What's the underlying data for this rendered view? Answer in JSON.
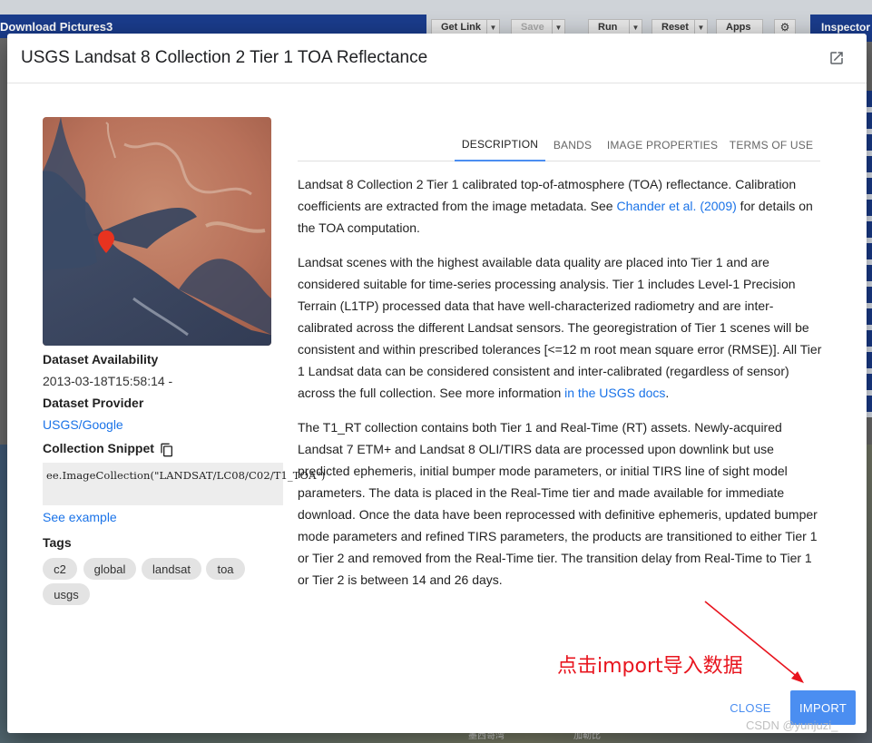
{
  "background": {
    "title": "Download Pictures3",
    "buttons": [
      "Get Link",
      "Save",
      "Run",
      "Reset",
      "Apps"
    ],
    "inspector": "Inspector",
    "map_labels": [
      "墨西哥湾",
      "加勒比"
    ]
  },
  "dialog": {
    "title": "USGS Landsat 8 Collection 2 Tier 1 TOA Reflectance",
    "sidebar": {
      "availability_label": "Dataset Availability",
      "availability_value": "2013-03-18T15:58:14 -",
      "provider_label": "Dataset Provider",
      "provider_value": "USGS/Google",
      "snippet_label": "Collection Snippet",
      "snippet_code": "ee.ImageCollection(\"LANDSAT/LC08/C02/T1_TOA\")",
      "see_example": "See example",
      "tags_label": "Tags",
      "tags": [
        "c2",
        "global",
        "landsat",
        "toa",
        "usgs"
      ]
    },
    "tabs": [
      "DESCRIPTION",
      "BANDS",
      "IMAGE PROPERTIES",
      "TERMS OF USE"
    ],
    "description": {
      "p1_a": "Landsat 8 Collection 2 Tier 1 calibrated top-of-atmosphere (TOA) reflectance. Calibration coefficients are extracted from the image metadata. See ",
      "p1_link": "Chander et al. (2009)",
      "p1_b": " for details on the TOA computation.",
      "p2_a": "Landsat scenes with the highest available data quality are placed into Tier 1 and are considered suitable for time-series processing analysis. Tier 1 includes Level-1 Precision Terrain (L1TP) processed data that have well-characterized radiometry and are inter-calibrated across the different Landsat sensors. The georegistration of Tier 1 scenes will be consistent and within prescribed tolerances [<=12 m root mean square error (RMSE)]. All Tier 1 Landsat data can be considered consistent and inter-calibrated (regardless of sensor) across the full collection. See more information ",
      "p2_link": "in the USGS docs",
      "p2_b": ".",
      "p3": "The T1_RT collection contains both Tier 1 and Real-Time (RT) assets. Newly-acquired Landsat 7 ETM+ and Landsat 8 OLI/TIRS data are processed upon downlink but use predicted ephemeris, initial bumper mode parameters, or initial TIRS line of sight model parameters. The data is placed in the Real-Time tier and made available for immediate download. Once the data have been reprocessed with definitive ephemeris, updated bumper mode parameters and refined TIRS parameters, the products are transitioned to either Tier 1 or Tier 2 and removed from the Real-Time tier. The transition delay from Real-Time to Tier 1 or Tier 2 is between 14 and 26 days."
    },
    "annotation": "点击import导入数据",
    "close_label": "CLOSE",
    "import_label": "IMPORT"
  },
  "watermark": "CSDN @yunjuzi_",
  "colors": {
    "accent": "#4b8ef1",
    "annotation": "#e8141e",
    "link": "#1a73e8"
  }
}
